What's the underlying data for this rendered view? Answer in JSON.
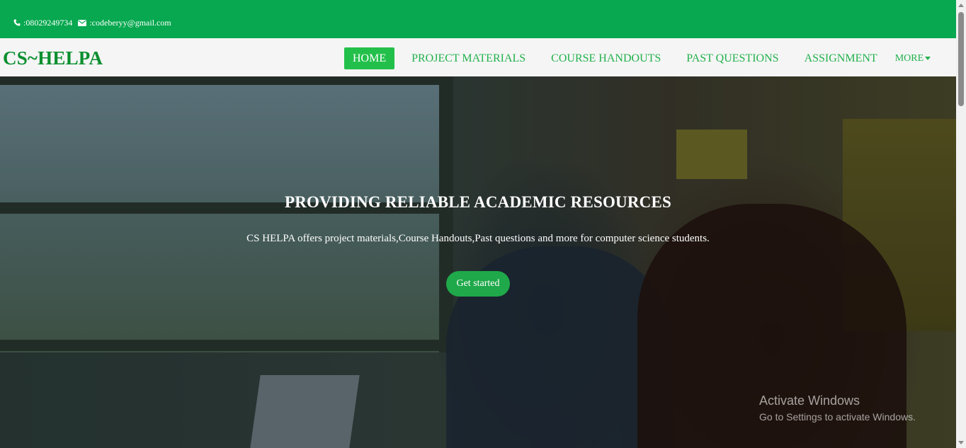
{
  "topbar": {
    "phone": ":08029249734",
    "email": ":codeberyy@gmail.com",
    "phone_icon": "phone-icon",
    "email_icon": "envelope-icon"
  },
  "navbar": {
    "brand": "CS~HELPA",
    "links": [
      "HOME",
      "PROJECT MATERIALS",
      "COURSE HANDOUTS",
      "PAST QUESTIONS",
      "ASSIGNMENT"
    ],
    "more_label": "MORE",
    "active": "HOME"
  },
  "hero": {
    "title": "PROVIDING RELIABLE ACADEMIC RESOURCES",
    "text": "CS HELPA offers project materials,Course Handouts,Past questions and more for computer science students.",
    "button": "Get started"
  },
  "watermark": {
    "line1": "Activate Windows",
    "line2": "Go to Settings to activate Windows."
  },
  "colors": {
    "primary_green": "#07a84f",
    "nav_text": "#22b14c",
    "brand": "#0a8f2f",
    "button": "#1fa94a"
  }
}
